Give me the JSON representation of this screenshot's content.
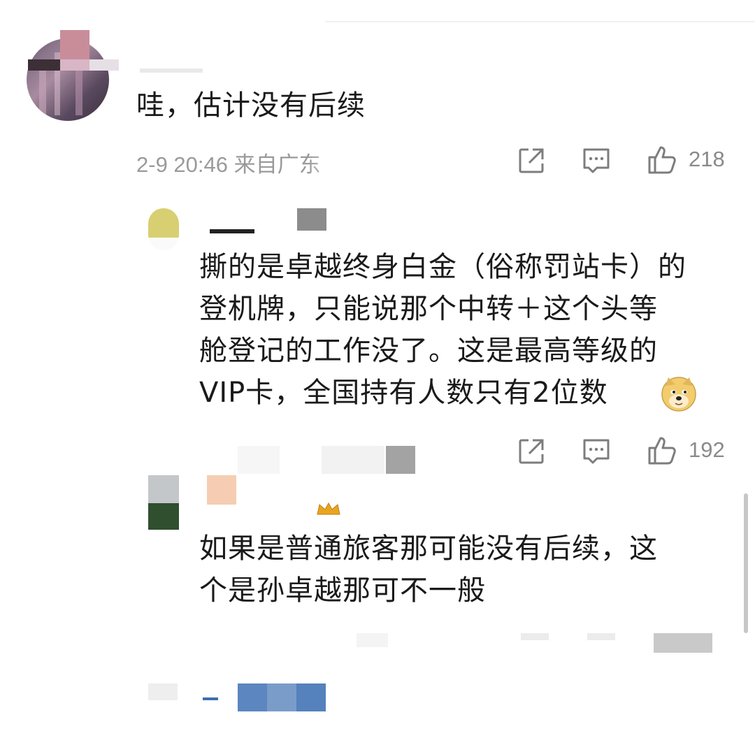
{
  "comments": [
    {
      "text": "哇，估计没有后续",
      "meta": "2-9 20:46 来自广东",
      "likes": "218"
    },
    {
      "lines": [
        "撕的是卓越终身白金（俗称罚站卡）的",
        "登机牌，只能说那个中转＋这个头等",
        "舱登记的工作没了。这是最高等级的",
        "VIP卡，全国持有人数只有2位数"
      ],
      "emoji": "doge-emoji",
      "likes": "192"
    },
    {
      "lines": [
        "如果是普通旅客那可能没有后续，这",
        "个是孙卓越那可不一般"
      ]
    }
  ],
  "icons": {
    "share": "share-icon",
    "comment": "comment-icon",
    "like": "thumbs-up-icon",
    "crown": "crown-icon"
  }
}
